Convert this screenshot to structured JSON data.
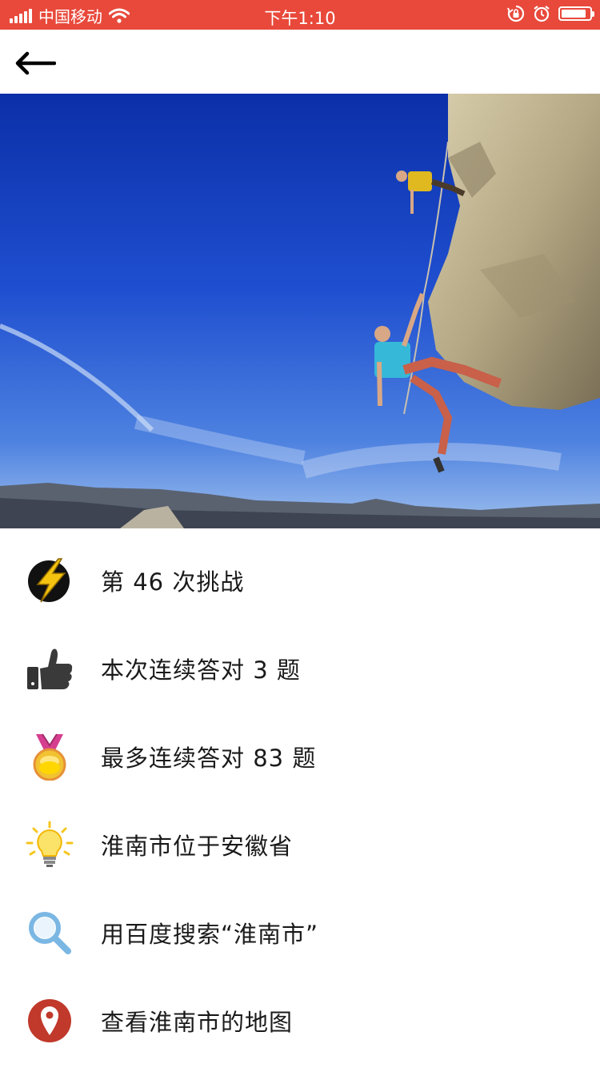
{
  "status_bar": {
    "carrier": "中国移动",
    "time": "下午1:10",
    "bg_color": "#e8493b"
  },
  "nav": {
    "back_icon": "arrow-left-icon"
  },
  "hero": {
    "icon": "rock-climbers-photo"
  },
  "items": [
    {
      "icon": "lightning-icon",
      "label": "第 46 次挑战"
    },
    {
      "icon": "thumbs-up-icon",
      "label": "本次连续答对 3 题"
    },
    {
      "icon": "medal-icon",
      "label": "最多连续答对 83 题"
    },
    {
      "icon": "light-bulb-icon",
      "label": "淮南市位于安徽省"
    },
    {
      "icon": "search-icon",
      "label": "用百度搜索“淮南市”"
    },
    {
      "icon": "map-pin-icon",
      "label": "查看淮南市的地图"
    }
  ]
}
